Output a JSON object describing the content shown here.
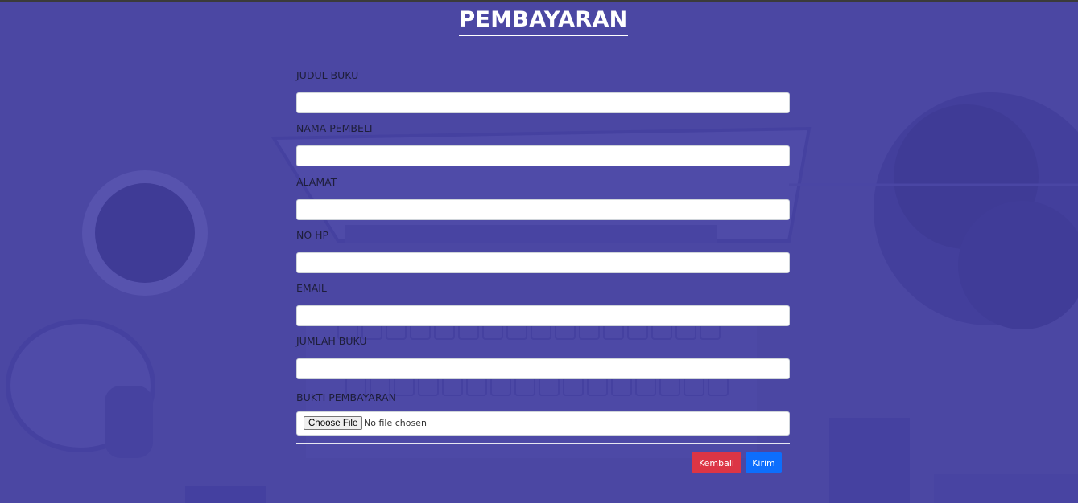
{
  "page": {
    "title": "PEMBAYARAN"
  },
  "form": {
    "fields": [
      {
        "label": "JUDUL BUKU",
        "value": ""
      },
      {
        "label": "NAMA PEMBELI",
        "value": ""
      },
      {
        "label": "ALAMAT",
        "value": ""
      },
      {
        "label": "NO HP",
        "value": ""
      },
      {
        "label": "EMAIL",
        "value": ""
      },
      {
        "label": "JUMLAH BUKU",
        "value": ""
      }
    ],
    "file_field": {
      "label": "BUKTI PEMBAYARAN",
      "button_label": "Choose File",
      "status": "No file chosen"
    },
    "buttons": {
      "back_label": "Kembali",
      "submit_label": "Kirim"
    }
  },
  "colors": {
    "background": "#4b47a3",
    "back_button": "#dc3545",
    "submit_button": "#0d6efd"
  }
}
